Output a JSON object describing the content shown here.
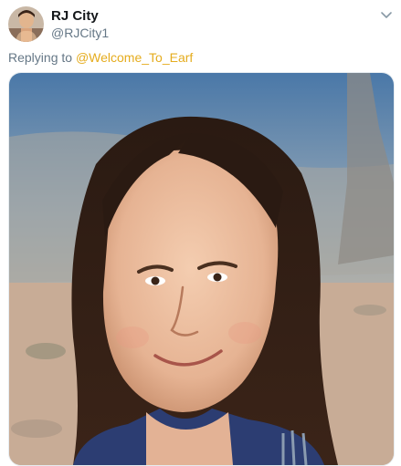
{
  "tweet": {
    "display_name": "RJ City",
    "handle": "@RJCity1",
    "reply_prefix": "Replying to ",
    "reply_mention": "@Welcome_To_Earf"
  },
  "icons": {
    "menu": "chevron-down-icon"
  },
  "colors": {
    "mention": "#e5ac1e",
    "secondary_text": "#657786",
    "primary_text": "#14171a"
  }
}
